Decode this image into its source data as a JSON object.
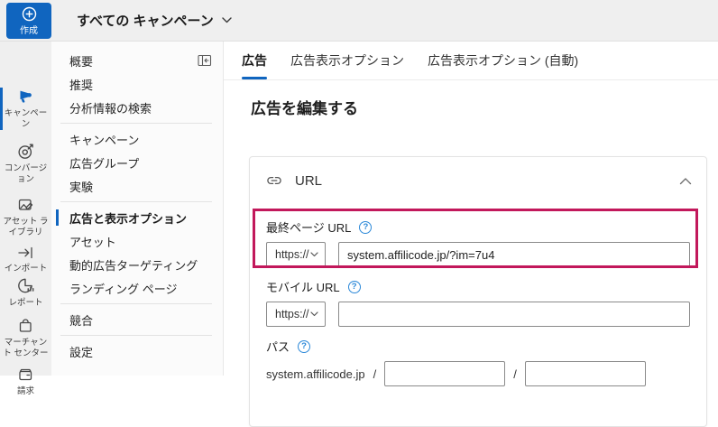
{
  "colors": {
    "accent": "#1065bf",
    "highlight_box": "#c2185b",
    "topbar_bg": "#efefef",
    "rail_bg": "#efefef",
    "nav_bg": "#fbfbfb",
    "help_blue": "#2b88d8"
  },
  "topbar": {
    "create_button": {
      "label": "作成",
      "icon": "circle-plus-icon"
    },
    "campaign_selector": {
      "label": "すべての キャンペーン",
      "icon": "chevron-down-icon"
    }
  },
  "rail": {
    "items": [
      {
        "label": "キャンペーン",
        "icon": "megaphone-icon",
        "selected": true
      },
      {
        "label": "コンバージョン",
        "icon": "target-icon",
        "selected": false
      },
      {
        "label": "アセット ライブラリ",
        "icon": "asset-library-icon",
        "selected": false
      },
      {
        "label": "インポート",
        "icon": "import-arrow-icon",
        "selected": false
      },
      {
        "label": "レポート",
        "icon": "report-chart-icon",
        "selected": false
      },
      {
        "label": "マーチャント センター",
        "icon": "shopping-bag-icon",
        "selected": false
      },
      {
        "label": "請求",
        "icon": "wallet-icon",
        "selected": false
      }
    ]
  },
  "nav": {
    "groups": [
      {
        "items": [
          {
            "label": "概要",
            "trailing_icon": "collapse-panel-icon"
          },
          {
            "label": "推奨"
          },
          {
            "label": "分析情報の検索"
          }
        ]
      },
      {
        "items": [
          {
            "label": "キャンペーン"
          },
          {
            "label": "広告グループ"
          },
          {
            "label": "実験"
          }
        ]
      },
      {
        "items": [
          {
            "label": "広告と表示オプション",
            "selected": true
          },
          {
            "label": "アセット"
          },
          {
            "label": "動的広告ターゲティング"
          },
          {
            "label": "ランディング ページ"
          }
        ]
      },
      {
        "items": [
          {
            "label": "競合"
          }
        ]
      },
      {
        "items": [
          {
            "label": "設定"
          }
        ]
      }
    ]
  },
  "main": {
    "tabs": [
      {
        "label": "広告",
        "selected": true
      },
      {
        "label": "広告表示オプション",
        "selected": false
      },
      {
        "label": "広告表示オプション (自動)",
        "selected": false
      }
    ],
    "heading": "広告を編集する",
    "url_card": {
      "title": "URL",
      "title_icon": "link-icon",
      "collapse_icon": "chevron-up-icon",
      "help_mark": "?",
      "final_url": {
        "label": "最終ページ URL",
        "protocol": "https://",
        "value": "system.affilicode.jp/?im=7u4",
        "highlighted": true
      },
      "mobile_url": {
        "label": "モバイル URL",
        "protocol": "https://",
        "value": ""
      },
      "path": {
        "label": "パス",
        "base": "system.affilicode.jp",
        "separator": "/",
        "path1": "",
        "path2": ""
      }
    }
  }
}
